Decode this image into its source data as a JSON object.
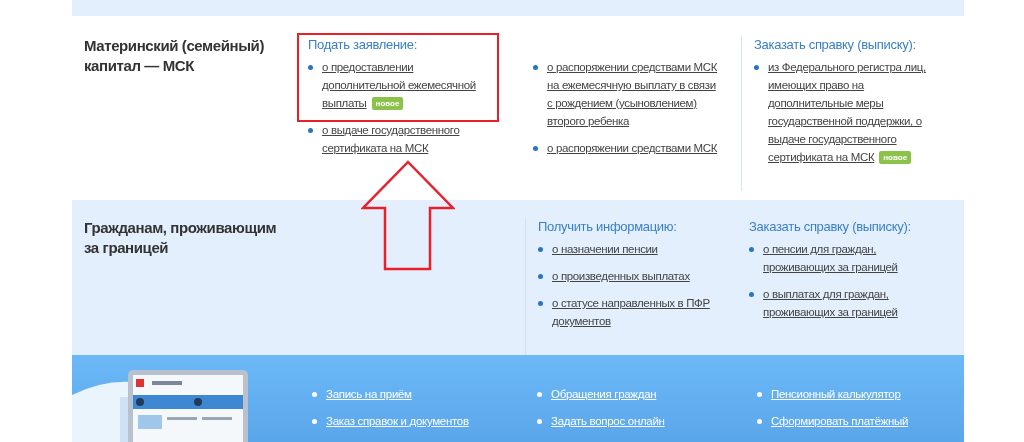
{
  "sections": [
    {
      "title": "Материнский (семейный) капитал — МСК",
      "columns": [
        {
          "heading": "Подать заявление:",
          "items": [
            {
              "text": "о предоставлении дополнительной ежемесячной выплаты",
              "badge": "новое"
            },
            {
              "text": "о выдаче государственного сертификата на МСК"
            }
          ]
        },
        {
          "items": [
            {
              "text": "о распоряжении средствами МСК на ежемесячную выплату в связи с рождением (усыновлением) второго ребенка"
            },
            {
              "text": "о распоряжении средствами МСК"
            }
          ]
        },
        {
          "heading": "Заказать справку (выписку):",
          "items": [
            {
              "text": "из Федерального регистра лиц, имеющих право на дополнительные меры государственной поддержки, о выдаче государственного сертификата на МСК",
              "badge": "новое"
            }
          ]
        }
      ]
    },
    {
      "title": "Гражданам, проживающим за границей",
      "columns": [
        {
          "heading": "Получить информацию:",
          "items": [
            {
              "text": "о назначении пенсии"
            },
            {
              "text": "о произведенных выплатах"
            },
            {
              "text": "о статусе направленных в ПФР документов"
            }
          ]
        },
        {
          "heading": "Заказать справку (выписку):",
          "items": [
            {
              "text": "о пенсии для граждан, проживающих за границей"
            },
            {
              "text": "о выплатах для граждан, проживающих за границей"
            }
          ]
        }
      ]
    }
  ],
  "footer": {
    "picture": {
      "kind": "picture"
    },
    "columns": [
      [
        "Запись на приём",
        "Заказ справок и документов"
      ],
      [
        "Обращения граждан",
        "Задать вопрос онлайн"
      ],
      [
        "Пенсионный калькулятор",
        "Сформировать платёжный"
      ]
    ]
  }
}
